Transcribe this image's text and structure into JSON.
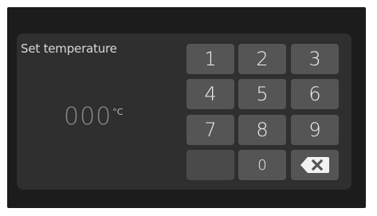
{
  "panel": {
    "title": "Set temperature",
    "value": "000",
    "unit": "°C"
  },
  "keypad": {
    "keys": [
      "1",
      "2",
      "3",
      "4",
      "5",
      "6",
      "7",
      "8",
      "9",
      "",
      "0"
    ],
    "backspace_icon": "backspace-icon"
  },
  "colors": {
    "screen_background": "#1c1c1c",
    "panel_background": "#2f2f2f",
    "key_background": "#555555",
    "key_text": "#eeeeee",
    "readout_text": "#8a8a8a"
  }
}
